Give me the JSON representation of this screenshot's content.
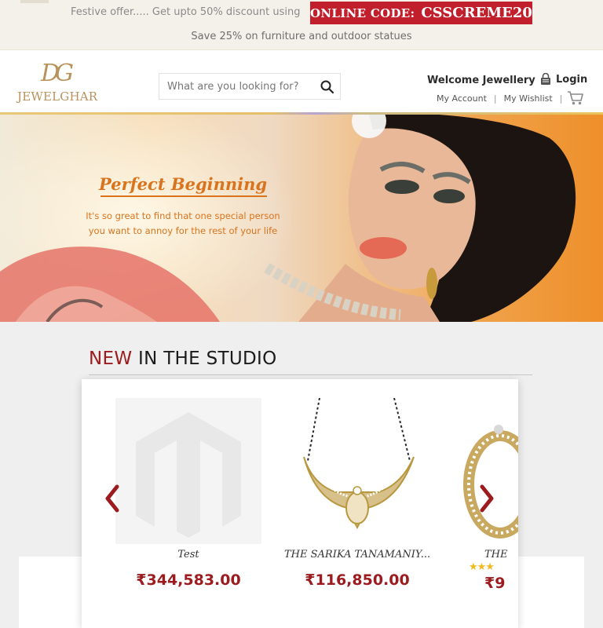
{
  "promo": {
    "offer_text": "Festive offer..... Get upto 50% discount using",
    "code_label": "ONLINE CODE:",
    "code_value": "CSSCREME20",
    "subtext": "Save 25% on furniture and outdoor statues",
    "code_bg_color": "#c21f2c"
  },
  "header": {
    "logo_mark": "DG",
    "logo_text": "JEWELGHAR",
    "search_placeholder": "What are you looking for?",
    "search_icon": "search-icon",
    "welcome_text": "Welcome Jewellery",
    "login_label": "Login",
    "login_icon": "lock-icon",
    "my_account": "My Account",
    "my_wishlist": "My Wishlist",
    "cart_icon": "cart-icon"
  },
  "banner": {
    "headline": "Perfect Beginning",
    "tagline": "It's so great to find that one special person you want to annoy for the rest of your life",
    "accent_color": "#d9741e"
  },
  "studio": {
    "title_accent": "NEW",
    "title_rest": " IN THE STUDIO",
    "accent_color": "#9b1b1e",
    "prev_icon": "chevron-left-icon",
    "next_icon": "chevron-right-icon",
    "products": [
      {
        "name": "Test",
        "price": "₹344,583.00",
        "image": "magento-placeholder-logo"
      },
      {
        "name": "THE SARIKA TANAMANIY...",
        "price": "₹116,850.00",
        "image": "mangalsutra-necklace"
      },
      {
        "name": "THE",
        "price": "₹9",
        "image": "ring",
        "rating": "★★★"
      }
    ]
  }
}
